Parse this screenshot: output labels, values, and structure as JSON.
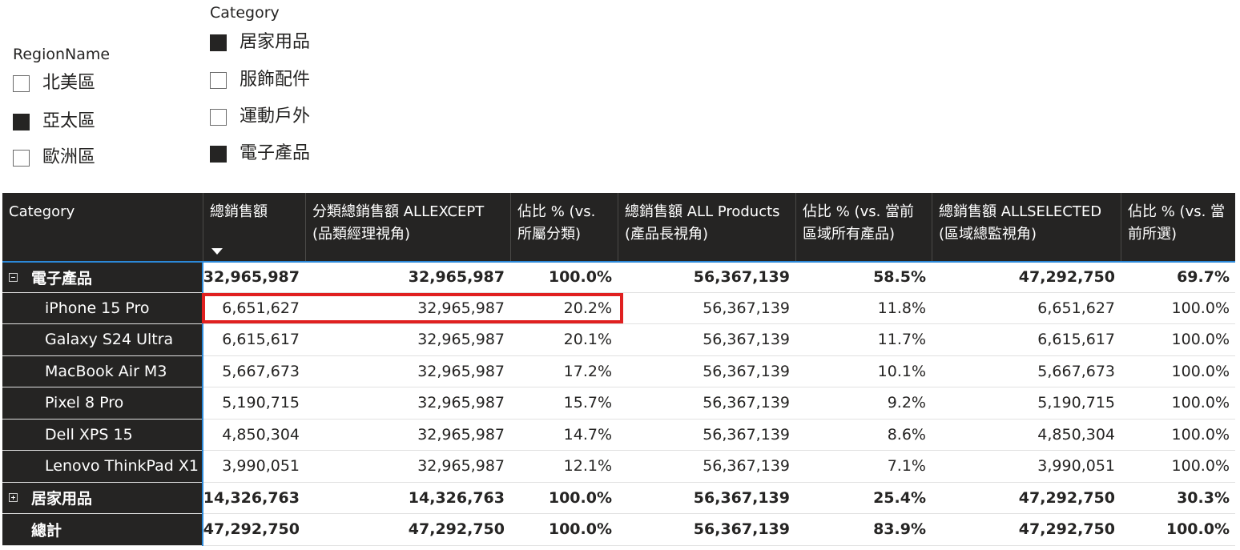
{
  "region_slicer": {
    "title": "RegionName",
    "items": [
      {
        "label": "北美區",
        "checked": false
      },
      {
        "label": "亞太區",
        "checked": true
      },
      {
        "label": "歐洲區",
        "checked": false
      }
    ]
  },
  "category_slicer": {
    "title": "Category",
    "items": [
      {
        "label": "居家用品",
        "checked": true
      },
      {
        "label": "服飾配件",
        "checked": false
      },
      {
        "label": "運動戶外",
        "checked": false
      },
      {
        "label": "電子產品",
        "checked": true
      }
    ]
  },
  "matrix": {
    "columns": [
      "Category",
      "總銷售額",
      "分類總銷售額 ALLEXCEPT (品類經理視角)",
      "佔比 % (vs. 所屬分類)",
      "總銷售額 ALL Products (產品長視角)",
      "佔比 % (vs. 當前區域所有產品)",
      "總銷售額 ALLSELECTED (區域總監視角)",
      "佔比 % (vs. 當前所選)"
    ],
    "sorted_column_index": 1,
    "rows": [
      {
        "type": "group",
        "expander": "minus",
        "label": "電子產品",
        "values": [
          "32,965,987",
          "32,965,987",
          "100.0%",
          "56,367,139",
          "58.5%",
          "47,292,750",
          "69.7%"
        ]
      },
      {
        "type": "child",
        "label": "iPhone 15 Pro",
        "values": [
          "6,651,627",
          "32,965,987",
          "20.2%",
          "56,367,139",
          "11.8%",
          "6,651,627",
          "100.0%"
        ]
      },
      {
        "type": "child",
        "label": "Galaxy S24 Ultra",
        "values": [
          "6,615,617",
          "32,965,987",
          "20.1%",
          "56,367,139",
          "11.7%",
          "6,615,617",
          "100.0%"
        ]
      },
      {
        "type": "child",
        "label": "MacBook Air M3",
        "values": [
          "5,667,673",
          "32,965,987",
          "17.2%",
          "56,367,139",
          "10.1%",
          "5,667,673",
          "100.0%"
        ]
      },
      {
        "type": "child",
        "label": "Pixel 8 Pro",
        "values": [
          "5,190,715",
          "32,965,987",
          "15.7%",
          "56,367,139",
          "9.2%",
          "5,190,715",
          "100.0%"
        ]
      },
      {
        "type": "child",
        "label": "Dell XPS 15",
        "values": [
          "4,850,304",
          "32,965,987",
          "14.7%",
          "56,367,139",
          "8.6%",
          "4,850,304",
          "100.0%"
        ]
      },
      {
        "type": "child",
        "label": "Lenovo ThinkPad X1",
        "values": [
          "3,990,051",
          "32,965,987",
          "12.1%",
          "56,367,139",
          "7.1%",
          "3,990,051",
          "100.0%"
        ]
      },
      {
        "type": "group",
        "expander": "plus",
        "label": "居家用品",
        "values": [
          "14,326,763",
          "14,326,763",
          "100.0%",
          "56,367,139",
          "25.4%",
          "47,292,750",
          "30.3%"
        ]
      },
      {
        "type": "total",
        "label": "總計",
        "values": [
          "47,292,750",
          "47,292,750",
          "100.0%",
          "56,367,139",
          "83.9%",
          "47,292,750",
          "100.0%"
        ]
      }
    ]
  },
  "colors": {
    "header_bg": "#252423",
    "accent_blue": "#2b88d8",
    "highlight_red": "#e02020"
  }
}
